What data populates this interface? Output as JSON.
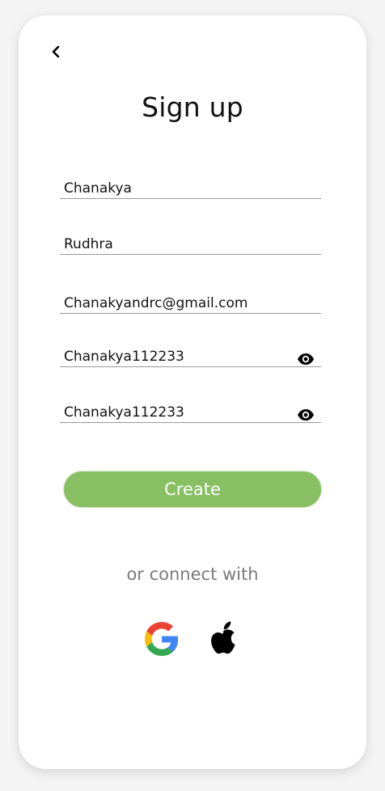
{
  "page": {
    "title": "Sign up"
  },
  "form": {
    "first_name": "Chanakya",
    "last_name": "Rudhra",
    "email": "Chanakyandrc@gmail.com",
    "password": "Chanakya112233",
    "confirm_password": "Chanakya112233"
  },
  "actions": {
    "create_label": "Create",
    "connect_text": "or connect with"
  },
  "icons": {
    "back": "chevron-left-icon",
    "password_visibility": "eye-icon",
    "google": "google-icon",
    "apple": "apple-icon"
  },
  "colors": {
    "primary": "#88bf63",
    "muted_text": "#7a7a7a"
  }
}
